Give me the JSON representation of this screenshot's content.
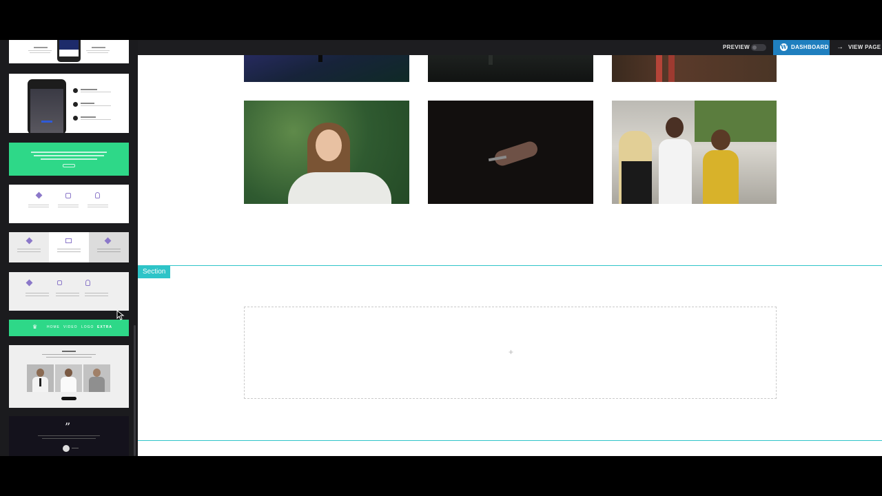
{
  "topbar": {
    "preview_label": "PREVIEW",
    "dashboard_label": "DASHBOARD",
    "view_page_label": "VIEW PAGE",
    "view_page_arrow": "→",
    "wp_glyph": "W"
  },
  "canvas": {
    "section_label": "Section",
    "dropzone_plus": "+"
  },
  "sidebar": {
    "nav_thumb_items": [
      "♛",
      "HOME",
      "VIDEO",
      "LOGO",
      "EXTRA"
    ],
    "testimonial_quote": "”"
  },
  "colors": {
    "accent_cyan": "#2ec4c8",
    "dashboard_blue": "#1f7fbf",
    "template_green": "#2ed888"
  }
}
